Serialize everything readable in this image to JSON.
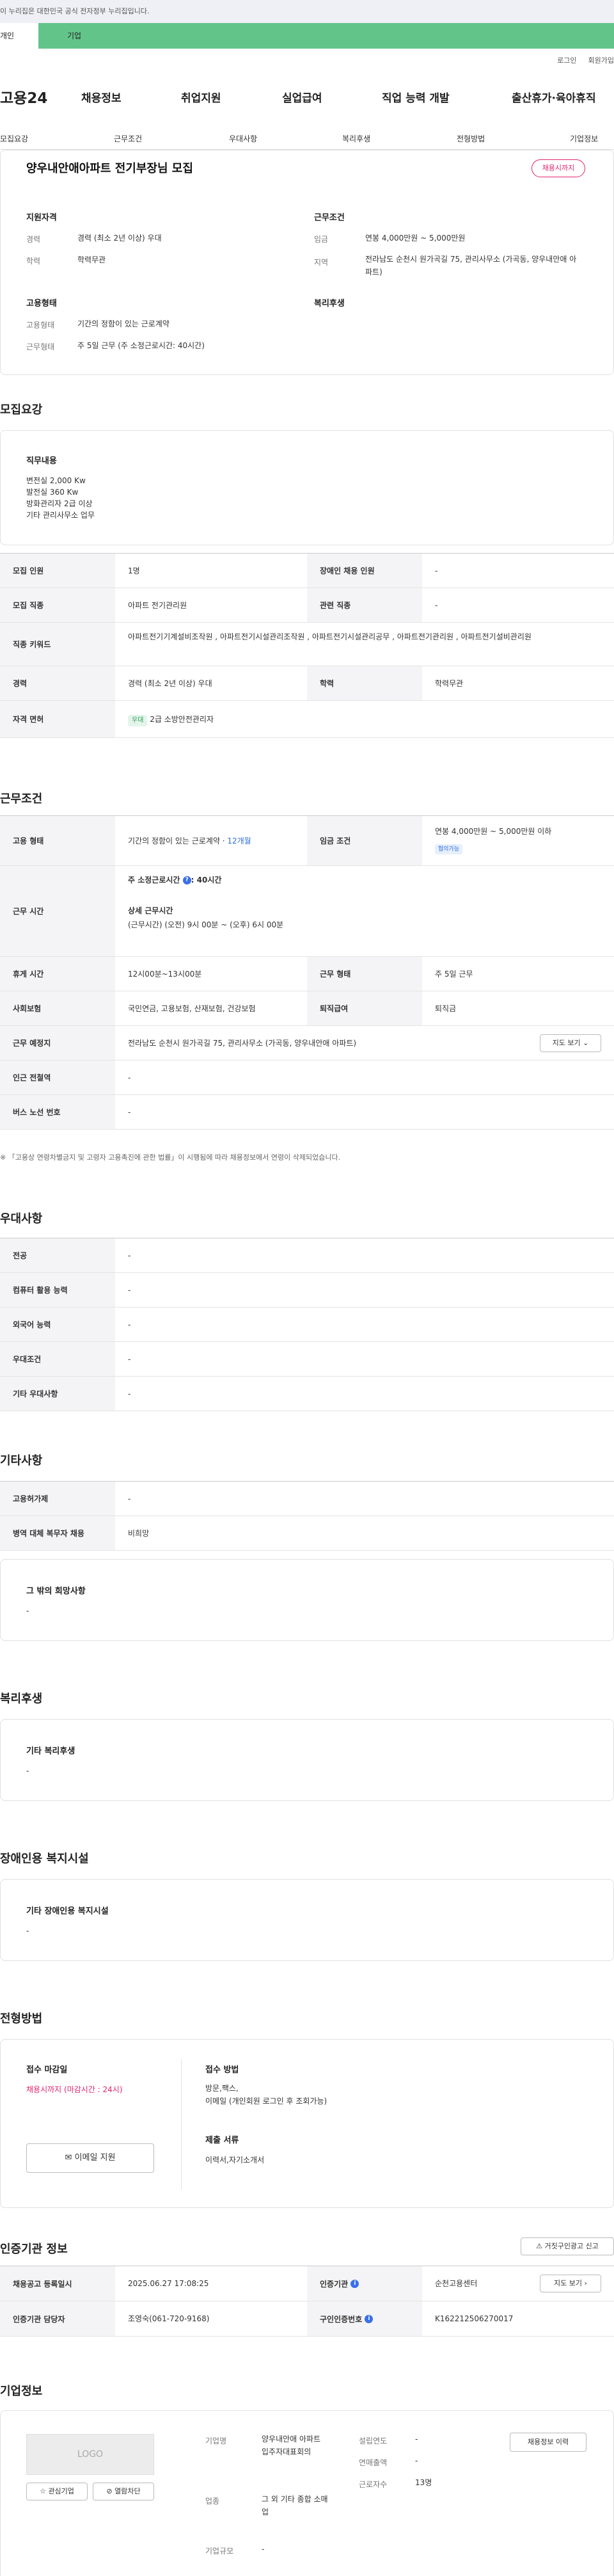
{
  "top": {
    "notice": "이 누리집은 대한민국 공식 전자정부 누리집입니다.",
    "tab1": "개인",
    "tab2": "기업",
    "login": "로그인",
    "join": "회원가입"
  },
  "gnb": {
    "logo": "고용24",
    "items": [
      "채용정보",
      "취업지원",
      "실업급여",
      "직업 능력 개발",
      "출산휴가·육아휴직"
    ]
  },
  "subnav": [
    "모집요강",
    "근무조건",
    "우대사항",
    "복리후생",
    "전형방법",
    "기업정보"
  ],
  "header": {
    "title": "양우내안애아파트 전기부장님 모집",
    "badge": "채용시까지",
    "qual_h": "지원자격",
    "cond_h": "근무조건",
    "career_l": "경력",
    "career_v": "경력 (최소 2년 이상) 우대",
    "edu_l": "학력",
    "edu_v": "학력무관",
    "wage_l": "임금",
    "wage_v": "연봉 4,000만원 ~ 5,000만원",
    "region_l": "지역",
    "region_v": "전라남도 순천시 원가곡길 75, 관리사무소 (가곡동, 양우내안애 아파트)",
    "emp_h": "고용형태",
    "welfare_h": "복리후생",
    "emptype_l": "고용형태",
    "emptype_v": "기간의 정함이 있는 근로계약",
    "worktype_l": "근무형태",
    "worktype_v": "주 5일 근무 (주 소정근로시간: 40시간)"
  },
  "recruit": {
    "title": "모집요강",
    "duty_h": "직무내용",
    "duty_lines": [
      "변전실 2,000 Kw",
      "발전실 360 Kw",
      "방화관리자 2급 이상",
      "기타 관리사무소 업무"
    ],
    "rows": {
      "count_l": "모집 인원",
      "count_v": "1명",
      "disabled_l": "장애인 채용 인원",
      "disabled_v": "-",
      "job_l": "모집 직종",
      "job_v": "아파트 전기관리원",
      "rel_l": "관련 직종",
      "rel_v": "-",
      "kw_l": "직종 키워드",
      "kw_v": "아파트전기기계설비조작원 , 아파트전기시설관리조작원 , 아파트전기시설관리공무 , 아파트전기관리원 , 아파트전기설비관리원",
      "career_l": "경력",
      "career_v": "경력 (최소 2년 이상) 우대",
      "edu_l": "학력",
      "edu_v": "학력무관",
      "lic_l": "자격 면허",
      "lic_tag": "우대",
      "lic_v": "2급 소방안전관리자"
    }
  },
  "work": {
    "title": "근무조건",
    "emp_l": "고용 형태",
    "emp_v": "기간의 정함이 있는 근로계약 · ",
    "emp_months": "12개월",
    "wage_l": "임금 조건",
    "wage_v": "연봉 4,000만원 ~ 5,000만원 이하",
    "wage_tag": "협의가능",
    "time_l": "근무 시간",
    "time_h": "주 소정근로시간",
    "time_v": ": 40시간",
    "time_detail_h": "상세 근무시간",
    "time_detail_v": "(근무시간) (오전) 9시 00분 ~ (오후) 6시 00분",
    "rest_l": "휴게 시간",
    "rest_v": "12시00분~13시00분",
    "form_l": "근무 형태",
    "form_v": "주 5일 근무",
    "ins_l": "사회보험",
    "ins_v": "국민연금, 고용보험, 산재보험, 건강보험",
    "sev_l": "퇴직급여",
    "sev_v": "퇴직금",
    "place_l": "근무 예정지",
    "place_v": "전라남도 순천시 원가곡길 75, 관리사무소 (가곡동, 양우내안애 아파트)",
    "map_btn": "지도 보기",
    "subway_l": "인근 전철역",
    "subway_v": "-",
    "bus_l": "버스 노선 번호",
    "bus_v": "-",
    "note": "「고용상 연령차별금지 및 고령자 고용촉진에 관한 법률」이 시행됨에 따라 채용정보에서 연령이 삭제되었습니다."
  },
  "pref": {
    "title": "우대사항",
    "rows": [
      {
        "l": "전공",
        "v": "-"
      },
      {
        "l": "컴퓨터 활용 능력",
        "v": "-"
      },
      {
        "l": "외국어 능력",
        "v": "-"
      },
      {
        "l": "우대조건",
        "v": "-"
      },
      {
        "l": "기타 우대사항",
        "v": "-"
      }
    ]
  },
  "etc": {
    "title": "기타사항",
    "rows": [
      {
        "l": "고용허가제",
        "v": "-"
      },
      {
        "l": "병역 대체 복무자 채용",
        "v": "비희망"
      }
    ],
    "box_h": "그 밖의 희망사항",
    "box_v": "-"
  },
  "welfare": {
    "title": "복리후생",
    "box_h": "기타 복리후생",
    "box_v": "-"
  },
  "disab": {
    "title": "장애인용 복지시설",
    "box_h": "기타 장애인용 복지시설",
    "box_v": "-"
  },
  "proc": {
    "title": "전형방법",
    "deadline_h": "접수 마감일",
    "deadline_v": "채용시까지 (마감시간 : 24시)",
    "method_h": "접수 방법",
    "method_v1": "방문,팩스,",
    "method_v2": "이메일 (개인회원 로그인 후 조회가능)",
    "docs_h": "제출 서류",
    "docs_v": "이력서,자기소개서",
    "email_btn": "이메일 지원"
  },
  "cert": {
    "title": "인증기관 정보",
    "report_btn": "거짓구인광고 신고",
    "reg_l": "채용공고 등록일시",
    "reg_v": "2025.06.27 17:08:25",
    "org_l": "인증기관",
    "org_v": "순천고용센터",
    "map_btn": "지도 보기",
    "mgr_l": "인증기관 담당자",
    "mgr_v": "조영숙(061-720-9168)",
    "no_l": "구인인증번호",
    "no_v": "K162212506270017"
  },
  "company": {
    "title": "기업정보",
    "logo": "LOGO",
    "fav_btn": "관심기업",
    "block_btn": "열람차단",
    "name_l": "기업명",
    "name_v": "양우내안애 아파트 입주자대표회의",
    "ind_l": "업종",
    "ind_v": "그 외 기타 종합 소매업",
    "size_l": "기업규모",
    "size_v": "-",
    "year_l": "설립연도",
    "year_v": "-",
    "sales_l": "연매출액",
    "sales_v": "-",
    "emp_l": "근로자수",
    "emp_v": "13명",
    "hist_btn": "채용정보 이력"
  }
}
